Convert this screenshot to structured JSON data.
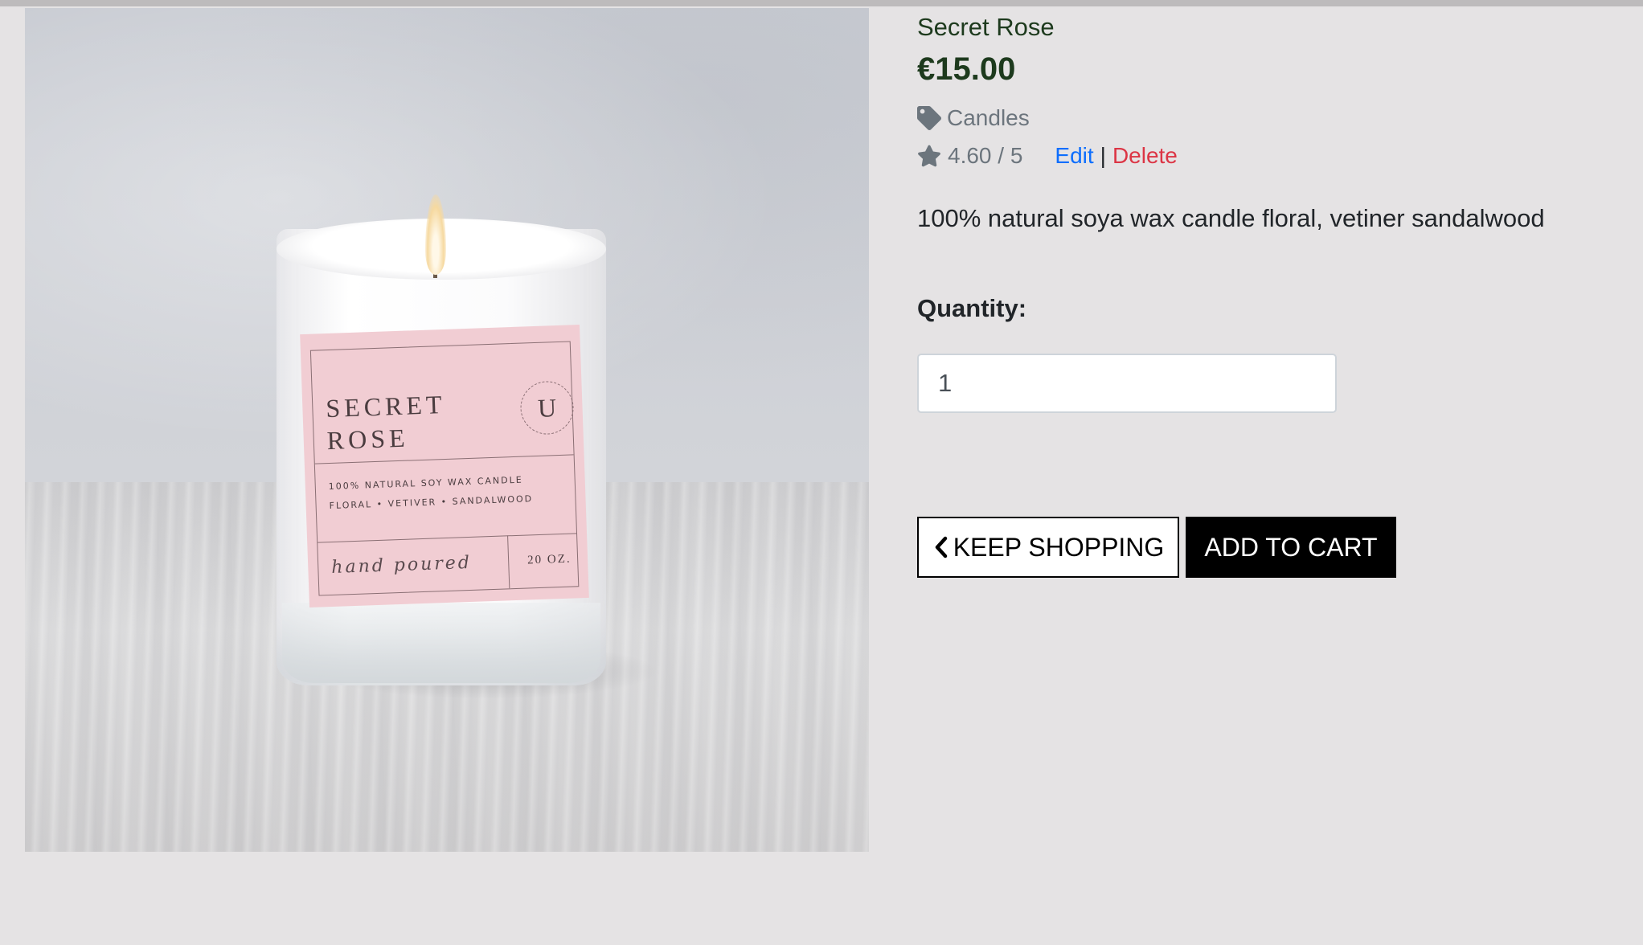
{
  "product": {
    "name": "Secret Rose",
    "price": "€15.00",
    "category": "Candles",
    "rating": "4.60 / 5",
    "description": "100% natural soya wax candle floral, vetiner sandalwood",
    "image": {
      "label_name_line1": "SECRET",
      "label_name_line2": "ROSE",
      "label_seal": "U",
      "label_desc_line1": "100% NATURAL SOY WAX CANDLE",
      "label_desc_line2": "FLORAL • VETIVER • SANDALWOOD",
      "label_script": "hand poured",
      "label_size": "20 OZ."
    }
  },
  "admin": {
    "edit_label": "Edit",
    "separator": "|",
    "delete_label": "Delete"
  },
  "quantity": {
    "label": "Quantity:",
    "value": "1"
  },
  "actions": {
    "keep_shopping_label": "KEEP SHOPPING",
    "add_to_cart_label": "ADD TO CART"
  },
  "icons": {
    "category": "tag-icon",
    "rating": "star-icon",
    "keep_shopping": "chevron-left-icon"
  },
  "colors": {
    "background": "#e5e3e4",
    "product_text": "#1d3a1d",
    "muted": "#6c757d",
    "link": "#0d6efd",
    "danger": "#dc3545"
  }
}
